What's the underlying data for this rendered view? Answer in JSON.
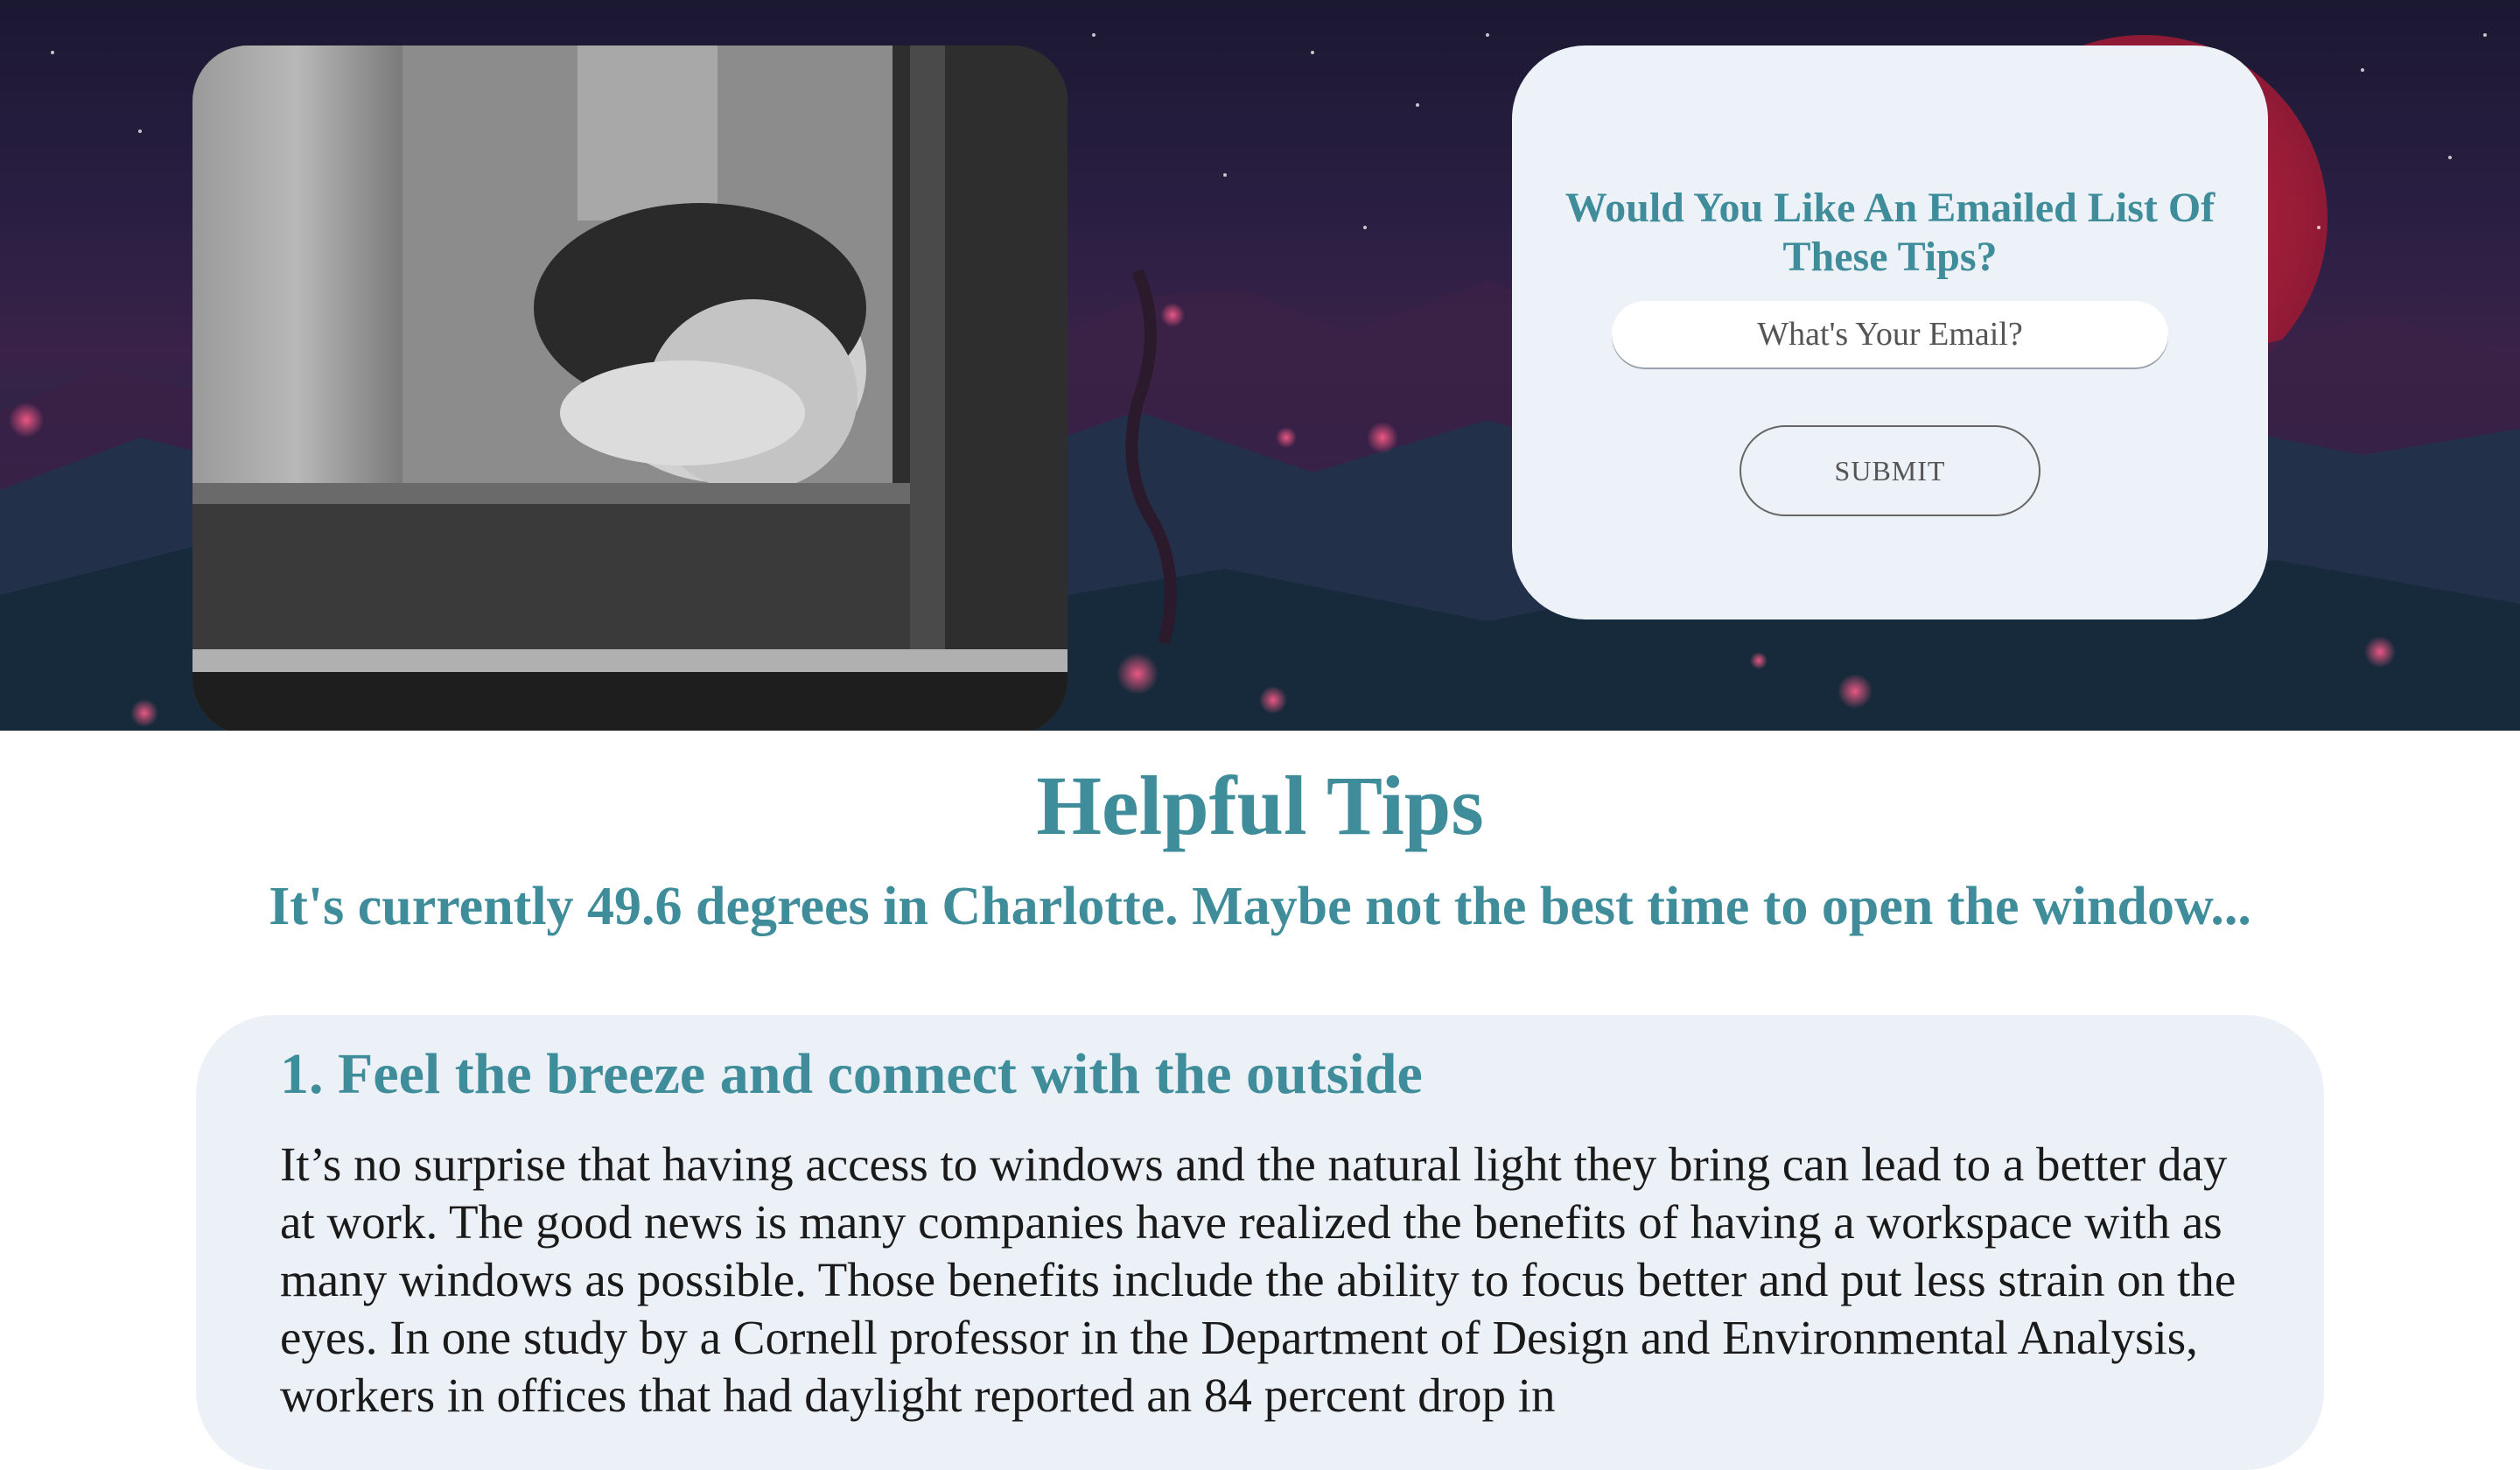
{
  "signup": {
    "title": "Would You Like An Emailed List Of These Tips?",
    "email_placeholder": "What's Your Email?",
    "submit_label": "SUBMIT"
  },
  "main": {
    "title": "Helpful Tips",
    "weather_message": "It's currently 49.6 degrees in Charlotte. Maybe not the best time to open the window..."
  },
  "tips": [
    {
      "heading": "1. Feel the breeze and connect with the outside",
      "body": "It’s no surprise that having access to windows and the natural light they bring can lead to a better day at work. The good news is many companies have realized the benefits of having a workspace with as many windows as possible. Those benefits include the ability to focus better and put less strain on the eyes. In one study by a Cornell professor in the Department of Design and Environmental Analysis, workers in offices that had daylight reported an 84 percent drop in"
    }
  ],
  "colors": {
    "accent": "#3f8c9a",
    "card_bg": "#edf2f8",
    "body_text": "#1a1a1a"
  },
  "icons": {
    "photo": "child-at-window-photo"
  }
}
